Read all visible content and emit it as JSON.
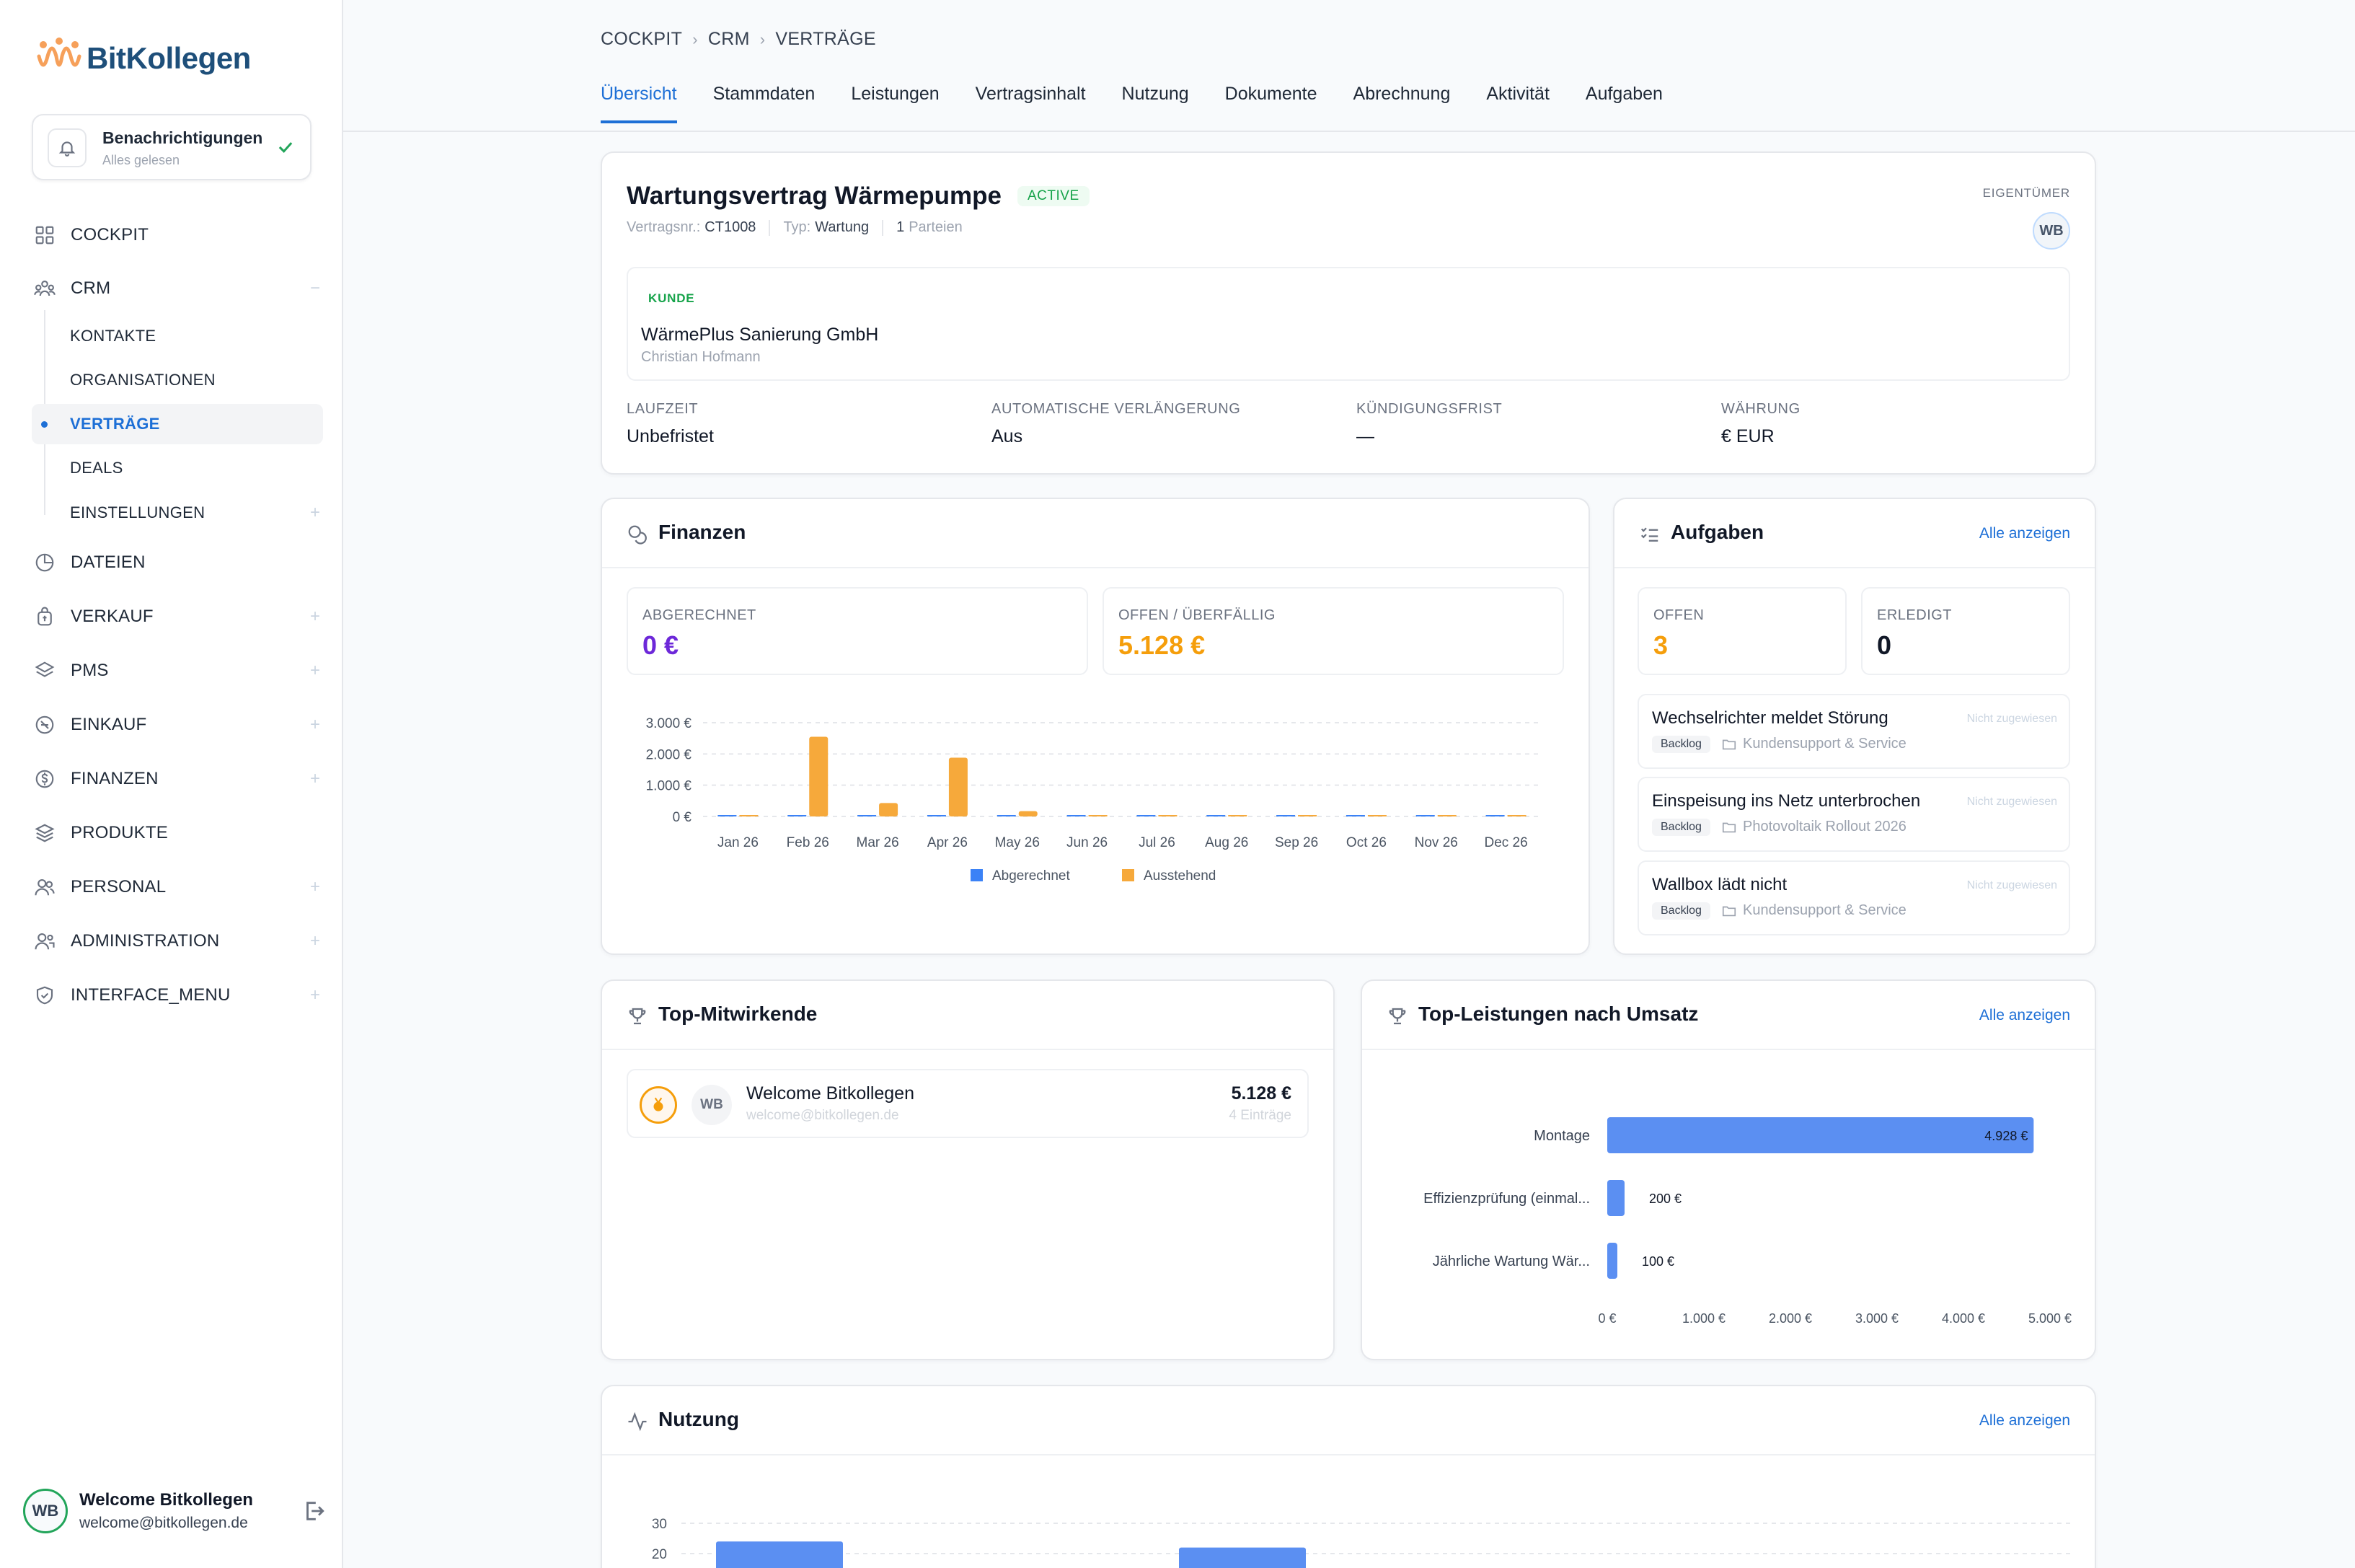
{
  "app": {
    "brand": "BitKollegen"
  },
  "notifications": {
    "title": "Benachrichtigungen",
    "subtitle": "Alles gelesen"
  },
  "sidebar": {
    "items": [
      {
        "label": "COCKPIT",
        "icon": "grid-icon"
      },
      {
        "label": "CRM",
        "icon": "users-icon",
        "toggle": "−"
      },
      {
        "label": "DATEIEN",
        "icon": "files-icon"
      },
      {
        "label": "VERKAUF",
        "icon": "bag-icon",
        "toggle": "+"
      },
      {
        "label": "PMS",
        "icon": "layers-icon",
        "toggle": "+"
      },
      {
        "label": "EINKAUF",
        "icon": "cart-icon",
        "toggle": "+"
      },
      {
        "label": "FINANZEN",
        "icon": "coin-icon",
        "toggle": "+"
      },
      {
        "label": "PRODUKTE",
        "icon": "stack-icon"
      },
      {
        "label": "PERSONAL",
        "icon": "people-icon",
        "toggle": "+"
      },
      {
        "label": "ADMINISTRATION",
        "icon": "admin-icon",
        "toggle": "+"
      },
      {
        "label": "INTERFACE_MENU",
        "icon": "shield-icon",
        "toggle": "+"
      }
    ],
    "crm_sub": [
      {
        "label": "KONTAKTE"
      },
      {
        "label": "ORGANISATIONEN"
      },
      {
        "label": "VERTRÄGE",
        "active": true
      },
      {
        "label": "DEALS"
      },
      {
        "label": "EINSTELLUNGEN",
        "toggle": "+"
      }
    ]
  },
  "user": {
    "initials": "WB",
    "name": "Welcome Bitkollegen",
    "email": "welcome@bitkollegen.de"
  },
  "breadcrumb": [
    "COCKPIT",
    "CRM",
    "VERTRÄGE"
  ],
  "tabs": [
    {
      "label": "Übersicht",
      "active": true
    },
    {
      "label": "Stammdaten"
    },
    {
      "label": "Leistungen"
    },
    {
      "label": "Vertragsinhalt"
    },
    {
      "label": "Nutzung"
    },
    {
      "label": "Dokumente"
    },
    {
      "label": "Abrechnung"
    },
    {
      "label": "Aktivität"
    },
    {
      "label": "Aufgaben"
    }
  ],
  "contract": {
    "title": "Wartungsvertrag Wärmepumpe",
    "status": "ACTIVE",
    "number_label": "Vertragsnr.:",
    "number": "CT1008",
    "type_label": "Typ:",
    "type": "Wartung",
    "parties_count": "1",
    "parties_label": "Parteien",
    "owner_label": "EIGENTÜMER",
    "owner_initials": "WB",
    "customer_label": "KUNDE",
    "customer_name": "WärmePlus Sanierung GmbH",
    "customer_person": "Christian Hofmann",
    "fields": [
      {
        "label": "LAUFZEIT",
        "value": "Unbefristet"
      },
      {
        "label": "AUTOMATISCHE VERLÄNGERUNG",
        "value": "Aus"
      },
      {
        "label": "KÜNDIGUNGSFRIST",
        "value": "—"
      },
      {
        "label": "WÄHRUNG",
        "value": "€ EUR"
      }
    ]
  },
  "finances": {
    "title": "Finanzen",
    "billed_label": "ABGERECHNET",
    "billed_value": "0 €",
    "open_label": "OFFEN / ÜBERFÄLLIG",
    "open_value": "5.128 €",
    "colors": {
      "billed": "#3b82f6",
      "pending": "#f6a93b",
      "billed_value": "#6d28d9",
      "open_value": "#f59e0b"
    }
  },
  "tasks": {
    "title": "Aufgaben",
    "link": "Alle anzeigen",
    "open_label": "OFFEN",
    "open_value": "3",
    "done_label": "ERLEDIGT",
    "done_value": "0",
    "items": [
      {
        "title": "Wechselrichter meldet Störung",
        "assignee": "Nicht zugewiesen",
        "status": "Backlog",
        "project": "Kundensupport & Service"
      },
      {
        "title": "Einspeisung ins Netz unterbrochen",
        "assignee": "Nicht zugewiesen",
        "status": "Backlog",
        "project": "Photovoltaik Rollout 2026"
      },
      {
        "title": "Wallbox lädt nicht",
        "assignee": "Nicht zugewiesen",
        "status": "Backlog",
        "project": "Kundensupport & Service"
      }
    ]
  },
  "contributors": {
    "title": "Top-Mitwirkende",
    "items": [
      {
        "initials": "WB",
        "name": "Welcome Bitkollegen",
        "email": "welcome@bitkollegen.de",
        "value": "5.128 €",
        "count": "4 Einträge"
      }
    ]
  },
  "top_services": {
    "title": "Top-Leistungen nach Umsatz",
    "link": "Alle anzeigen"
  },
  "usage": {
    "title": "Nutzung",
    "link": "Alle anzeigen"
  },
  "chart_data": [
    {
      "id": "finance",
      "type": "bar",
      "categories": [
        "Jan 26",
        "Feb 26",
        "Mar 26",
        "Apr 26",
        "May 26",
        "Jun 26",
        "Jul 26",
        "Aug 26",
        "Sep 26",
        "Oct 26",
        "Nov 26",
        "Dec 26"
      ],
      "series": [
        {
          "name": "Abgerechnet",
          "color": "#3b82f6",
          "values": [
            0,
            0,
            0,
            0,
            0,
            0,
            0,
            0,
            0,
            0,
            0,
            0
          ]
        },
        {
          "name": "Ausstehend",
          "color": "#f6a93b",
          "values": [
            0,
            2550,
            430,
            1880,
            170,
            0,
            0,
            0,
            0,
            0,
            0,
            0
          ]
        }
      ],
      "yticks": [
        "0 €",
        "1.000 €",
        "2.000 €",
        "3.000 €"
      ],
      "ylim": [
        0,
        3000
      ],
      "grid": true,
      "legend": "bottom"
    },
    {
      "id": "services",
      "type": "bar",
      "orientation": "horizontal",
      "categories": [
        "Montage",
        "Effizienzprüfung (einmal...",
        "Jährliche Wartung Wär..."
      ],
      "values": [
        4928,
        200,
        100
      ],
      "value_labels": [
        "4.928 €",
        "200 €",
        "100 €"
      ],
      "color": "#5b8ff2",
      "xticks": [
        "0 €",
        "1.000 €",
        "2.000 €",
        "3.000 €",
        "4.000 €",
        "5.000 €"
      ],
      "xlim": [
        0,
        5000
      ]
    },
    {
      "id": "usage",
      "type": "bar",
      "yticks": [
        "20",
        "30"
      ],
      "values": [
        24,
        22
      ],
      "color": "#5b8ff2",
      "ylim": [
        0,
        30
      ]
    }
  ]
}
